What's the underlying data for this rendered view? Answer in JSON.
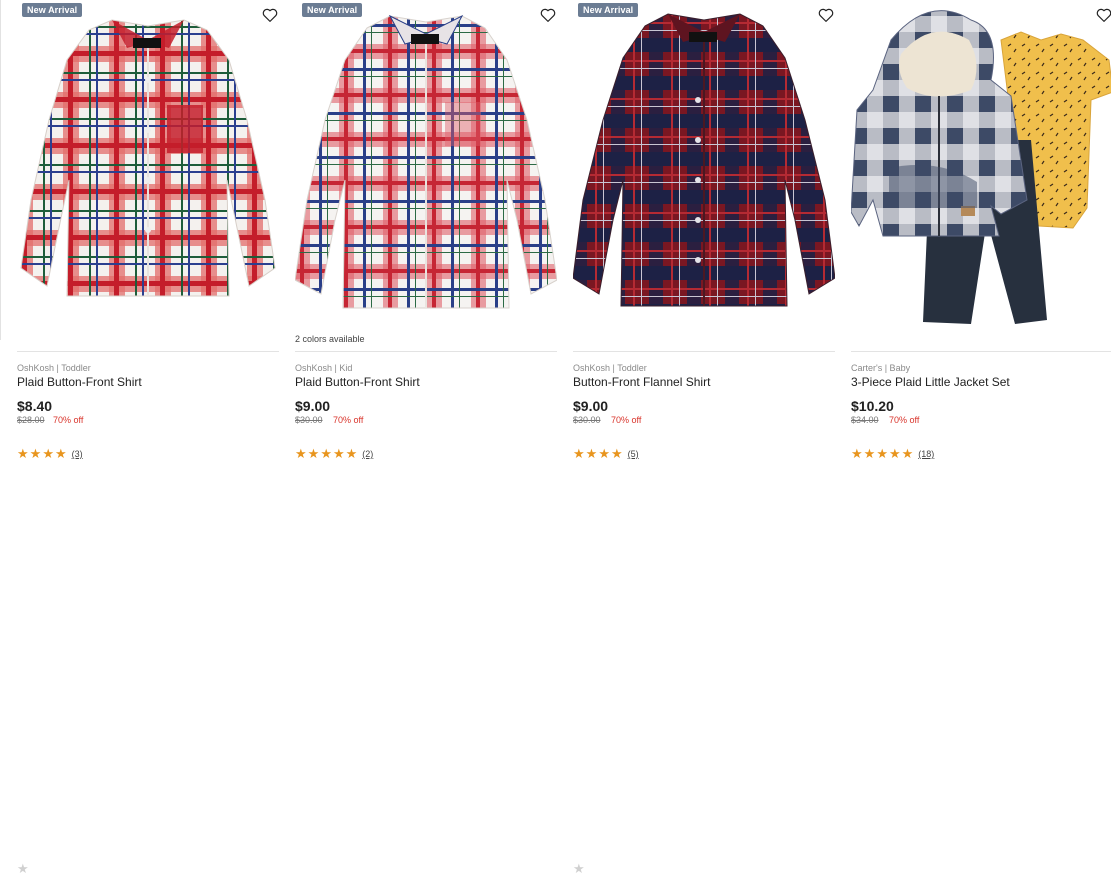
{
  "products": [
    {
      "badge": "New Arrival",
      "brand": "OshKosh | Toddler",
      "name": "Plaid Button-Front Shirt",
      "price": "$8.40",
      "original_price": "$28.00",
      "discount": "70% off",
      "rating": 4,
      "reviews": "(3)",
      "colors": ""
    },
    {
      "badge": "New Arrival",
      "brand": "OshKosh | Kid",
      "name": "Plaid Button-Front Shirt",
      "price": "$9.00",
      "original_price": "$30.00",
      "discount": "70% off",
      "rating": 5,
      "reviews": "(2)",
      "colors": "2 colors available"
    },
    {
      "badge": "New Arrival",
      "brand": "OshKosh | Toddler",
      "name": "Button-Front Flannel Shirt",
      "price": "$9.00",
      "original_price": "$30.00",
      "discount": "70% off",
      "rating": 4,
      "reviews": "(5)",
      "colors": ""
    },
    {
      "badge": "",
      "brand": "Carter's | Baby",
      "name": "3-Piece Plaid Little Jacket Set",
      "price": "$10.20",
      "original_price": "$34.00",
      "discount": "70% off",
      "rating": 5,
      "reviews": "(18)",
      "colors": ""
    }
  ],
  "icons": {
    "favorite": "heart-outline-icon",
    "star": "star-icon"
  },
  "colors": {
    "badge_bg": "#6b7c93",
    "discount": "#d9342b",
    "star": "#e8951e"
  }
}
